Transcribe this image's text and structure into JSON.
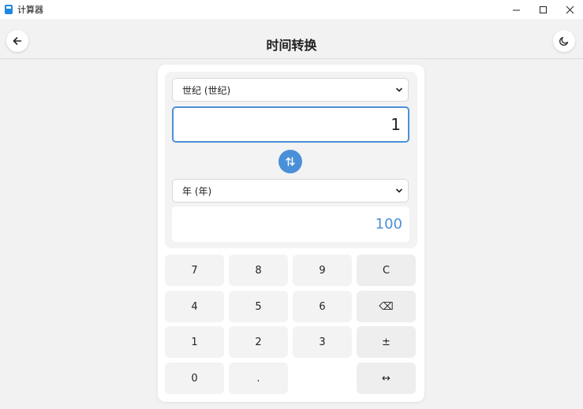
{
  "window": {
    "title": "计算器",
    "icons": {
      "app": "calculator-app-icon",
      "minimize": "minimize-icon",
      "maximize": "maximize-icon",
      "close": "close-icon"
    }
  },
  "header": {
    "title": "时间转换",
    "icons": {
      "back": "back-arrow-icon",
      "theme": "moon-icon"
    }
  },
  "converter": {
    "from_unit": "世纪 (世纪)",
    "input_value": "1",
    "to_unit": "年 (年)",
    "result_value": "100",
    "swap_icon": "swap-vertical-icon",
    "colors": {
      "accent": "#4a90d9",
      "result_text": "#4a8fd6"
    }
  },
  "keypad": {
    "keys": [
      "7",
      "8",
      "9",
      "C",
      "4",
      "5",
      "6",
      "⌫",
      "1",
      "2",
      "3",
      "±",
      "0",
      ".",
      "",
      "↔"
    ]
  }
}
